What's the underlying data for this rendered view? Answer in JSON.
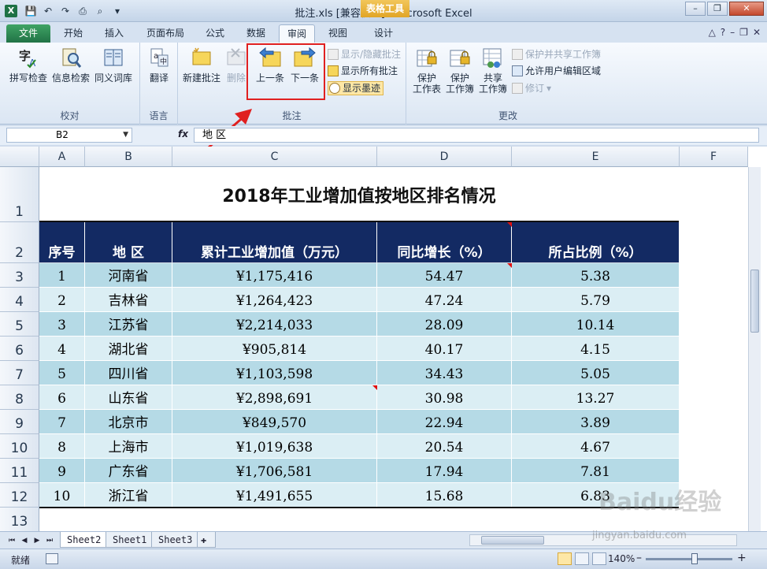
{
  "window": {
    "title": "批注.xls  [兼容模式] - Microsoft Excel",
    "context_tab": "表格工具"
  },
  "tabs": {
    "file": "文件",
    "items": [
      "开始",
      "插入",
      "页面布局",
      "公式",
      "数据",
      "审阅",
      "视图",
      "设计"
    ],
    "active": "审阅"
  },
  "ribbon": {
    "proofing": {
      "label": "校对",
      "spell": "拼写检查",
      "research": "信息检索",
      "thesaurus": "同义词库"
    },
    "language": {
      "label": "语言",
      "translate": "翻译"
    },
    "comments": {
      "label": "批注",
      "new": "新建批注",
      "delete": "删除",
      "prev": "上一条",
      "next": "下一条",
      "show_hide": "显示/隐藏批注",
      "show_all": "显示所有批注",
      "show_ink": "显示墨迹"
    },
    "changes": {
      "label": "更改",
      "protect_sheet_1": "保护",
      "protect_sheet_2": "工作表",
      "protect_book_1": "保护",
      "protect_book_2": "工作簿",
      "share_book_1": "共享",
      "share_book_2": "工作簿",
      "protect_share": "保护并共享工作簿",
      "allow_edit": "允许用户编辑区域",
      "track": "修订"
    }
  },
  "formula_bar": {
    "name_box": "B2",
    "fx": "fx",
    "content": "地  区"
  },
  "grid": {
    "columns": [
      "A",
      "B",
      "C",
      "D",
      "E",
      "F"
    ],
    "rows": [
      "1",
      "2",
      "3",
      "4",
      "5",
      "6",
      "7",
      "8",
      "9",
      "10",
      "11",
      "12",
      "13"
    ],
    "title": "2018年工业增加值按地区排名情况",
    "headers": [
      "序号",
      "地  区",
      "累计工业增加值（万元）",
      "同比增长（%）",
      "所占比例（%）"
    ],
    "data": [
      [
        "1",
        "河南省",
        "¥1,175,416",
        "54.47",
        "5.38"
      ],
      [
        "2",
        "吉林省",
        "¥1,264,423",
        "47.24",
        "5.79"
      ],
      [
        "3",
        "江苏省",
        "¥2,214,033",
        "28.09",
        "10.14"
      ],
      [
        "4",
        "湖北省",
        "¥905,814",
        "40.17",
        "4.15"
      ],
      [
        "5",
        "四川省",
        "¥1,103,598",
        "34.43",
        "5.05"
      ],
      [
        "6",
        "山东省",
        "¥2,898,691",
        "30.98",
        "13.27"
      ],
      [
        "7",
        "北京市",
        "¥849,570",
        "22.94",
        "3.89"
      ],
      [
        "8",
        "上海市",
        "¥1,019,638",
        "20.54",
        "4.67"
      ],
      [
        "9",
        "广东省",
        "¥1,706,581",
        "17.94",
        "7.81"
      ],
      [
        "10",
        "浙江省",
        "¥1,491,655",
        "15.68",
        "6.83"
      ]
    ]
  },
  "sheets": [
    "Sheet2",
    "Sheet1",
    "Sheet3"
  ],
  "active_sheet": "Sheet2",
  "status": {
    "ready": "就绪",
    "zoom": "140%"
  },
  "watermark": {
    "logo": "Baidu经验",
    "url": "jingyan.baidu.com"
  },
  "colors": {
    "header_bg": "#132a63",
    "row_dark": "#b5dae6",
    "row_light": "#dbeef4",
    "excel_green": "#217346",
    "highlight": "#e02020"
  }
}
